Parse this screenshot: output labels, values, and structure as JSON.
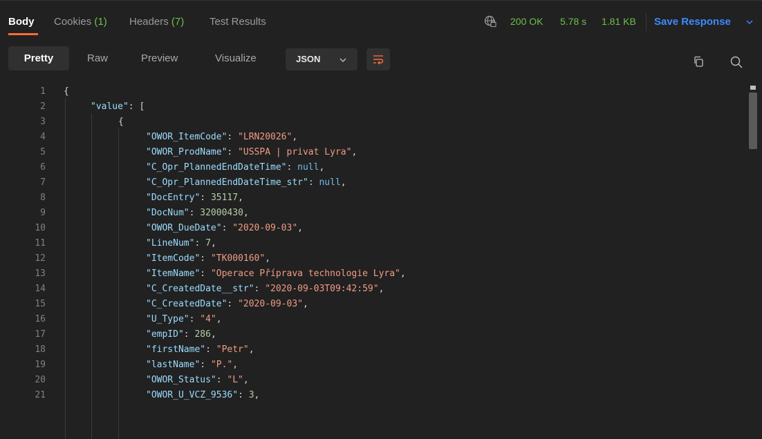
{
  "response_tabs": [
    {
      "label": "Body",
      "count": ""
    },
    {
      "label": "Cookies",
      "count": "(1)"
    },
    {
      "label": "Headers",
      "count": "(7)"
    },
    {
      "label": "Test Results",
      "count": ""
    }
  ],
  "status": {
    "code": "200 OK",
    "time": "5.78 s",
    "size": "1.81 KB"
  },
  "save_response_label": "Save Response",
  "view_modes": [
    "Pretty",
    "Raw",
    "Preview",
    "Visualize"
  ],
  "format_select": "JSON",
  "icons": {
    "globe": "globe-lock-icon",
    "wrap": "wrap-lines-icon",
    "copy": "copy-icon",
    "search": "search-icon"
  },
  "colors": {
    "accent_tab": "#ff6c37",
    "status_green": "#6cc04a",
    "link_blue": "#3d8bfd",
    "json_key": "#9cdcfe",
    "json_string": "#f29c85",
    "json_number": "#b5cea8"
  },
  "code_lines": [
    {
      "n": "1",
      "text": "{"
    },
    {
      "n": "2",
      "text": "\"value\": ["
    },
    {
      "n": "3",
      "text": "{"
    },
    {
      "n": "4",
      "text": "\"OWOR_ItemCode\": \"LRN20026\","
    },
    {
      "n": "5",
      "text": "\"OWOR_ProdName\": \"USSPA | privat Lyra\","
    },
    {
      "n": "6",
      "text": "\"C_Opr_PlannedEndDateTime\": null,"
    },
    {
      "n": "7",
      "text": "\"C_Opr_PlannedEndDateTime_str\": null,"
    },
    {
      "n": "8",
      "text": "\"DocEntry\": 35117,"
    },
    {
      "n": "9",
      "text": "\"DocNum\": 32000430,"
    },
    {
      "n": "10",
      "text": "\"OWOR_DueDate\": \"2020-09-03\","
    },
    {
      "n": "11",
      "text": "\"LineNum\": 7,"
    },
    {
      "n": "12",
      "text": "\"ItemCode\": \"TK000160\","
    },
    {
      "n": "13",
      "text": "\"ItemName\": \"Operace Příprava technologie Lyra\","
    },
    {
      "n": "14",
      "text": "\"C_CreatedDate__str\": \"2020-09-03T09:42:59\","
    },
    {
      "n": "15",
      "text": "\"C_CreatedDate\": \"2020-09-03\","
    },
    {
      "n": "16",
      "text": "\"U_Type\": \"4\","
    },
    {
      "n": "17",
      "text": "\"empID\": 286,"
    },
    {
      "n": "18",
      "text": "\"firstName\": \"Petr\","
    },
    {
      "n": "19",
      "text": "\"lastName\": \"P.\","
    },
    {
      "n": "20",
      "text": "\"OWOR_Status\": \"L\","
    },
    {
      "n": "21",
      "text": "\"OWOR_U_VCZ_9536\": 3,"
    }
  ]
}
